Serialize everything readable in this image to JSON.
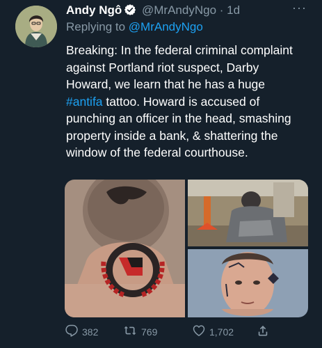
{
  "tweet": {
    "author_name": "Andy Ngô",
    "author_handle": "@MrAndyNgo",
    "separator": "·",
    "timestamp": "1d",
    "replying_prefix": "Replying to ",
    "replying_handle": "@MrAndyNgo",
    "text_before_tag": "Breaking: In the federal criminal complaint against Portland riot suspect, Darby Howard, we learn that he has a huge ",
    "hashtag": "#antifa",
    "text_after_tag": " tattoo. Howard is accused of punching an officer in the head, smashing property inside a bank, & shattering the window of the federal courthouse.",
    "more_label": "···"
  },
  "actions": {
    "reply_count": "382",
    "retweet_count": "769",
    "like_count": "1,702"
  },
  "icons": {
    "verified": "verified-badge-icon",
    "more": "more-options-icon",
    "reply": "reply-icon",
    "retweet": "retweet-icon",
    "like": "heart-icon",
    "share": "share-icon"
  },
  "colors": {
    "background": "#15202b",
    "text": "#ffffff",
    "secondary": "#8899a6",
    "link": "#1da1f2"
  }
}
